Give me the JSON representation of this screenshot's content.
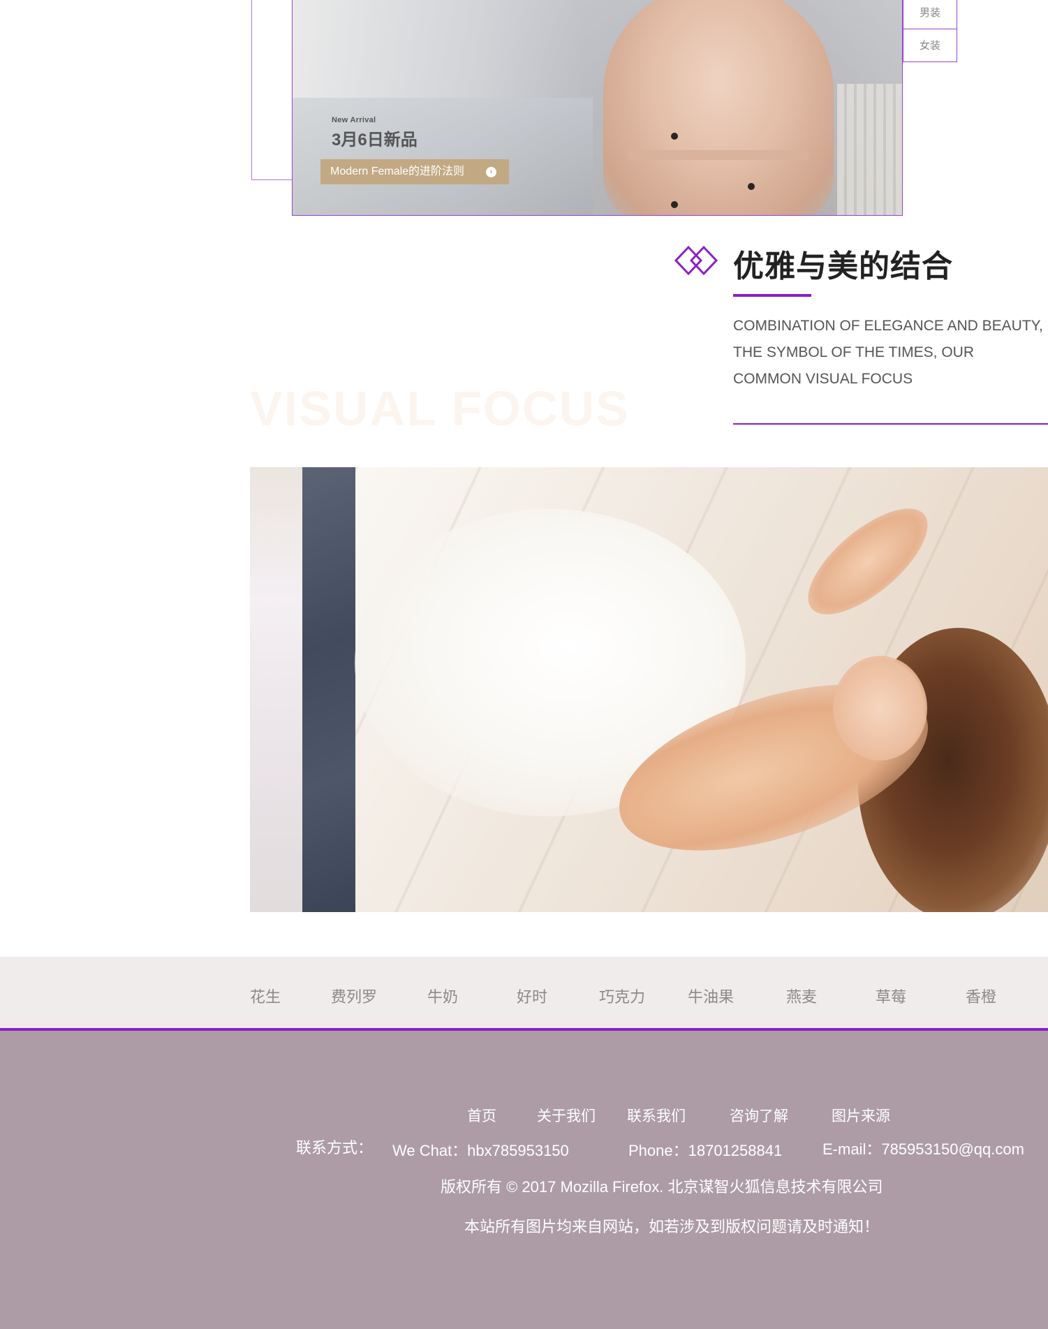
{
  "hero": {
    "kicker": "New Arrival",
    "title": "3月6日新品",
    "cta_label": "Modern Female的进阶法则",
    "cta_arrow_icon": "chevron-right-circle-icon",
    "side_tabs": [
      "男装",
      "女装"
    ]
  },
  "elegance": {
    "icon": "double-diamond-icon",
    "title": "优雅与美的结合",
    "description": [
      "COMBINATION OF ELEGANCE AND BEAUTY,",
      "THE SYMBOL OF THE TIMES, OUR",
      "COMMON VISUAL FOCUS"
    ],
    "watermark": "VISUAL FOCUS",
    "accent_color": "#8b1fc6"
  },
  "brands": [
    "花生",
    "费列罗",
    "牛奶",
    "好时",
    "巧克力",
    "牛油果",
    "燕麦",
    "草莓",
    "香橙"
  ],
  "footer": {
    "links": [
      "首页",
      "关于我们",
      "联系我们",
      "咨询了解",
      "图片来源"
    ],
    "contact_label": "联系方式：",
    "wechat": "We Chat：hbx785953150",
    "phone": "Phone：18701258841",
    "email": "E-mail：785953150@qq.com",
    "copyright": "版权所有 © 2017 Mozilla Firefox. 北京谋智火狐信息技术有限公司",
    "notice": "本站所有图片均来自网站，如若涉及到版权问题请及时通知！",
    "background": "#ad9ca6"
  }
}
